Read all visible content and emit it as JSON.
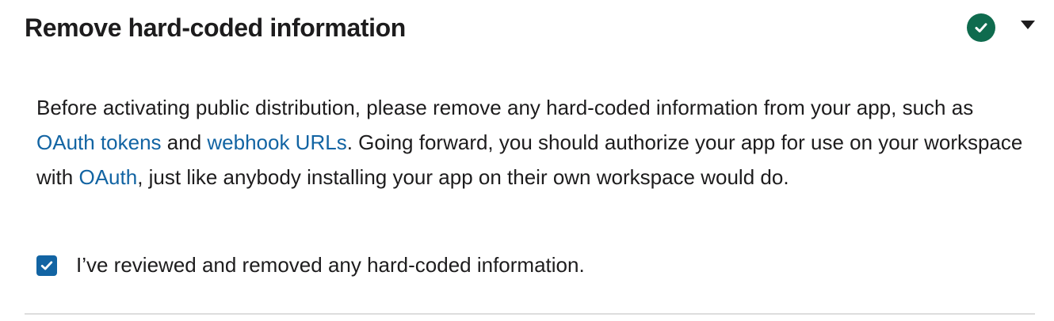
{
  "section": {
    "title": "Remove hard-coded information",
    "status_icon": "check-circle-icon",
    "status_color": "#0f6b4e",
    "toggle_icon": "caret-down-icon"
  },
  "description": {
    "part1": "Before activating public distribution, please remove any hard-coded information from your app, such as ",
    "link_oauth_tokens": "OAuth tokens",
    "part2": " and ",
    "link_webhook_urls": "webhook URLs",
    "part3": ". Going forward, you should authorize your app for use on your workspace with ",
    "link_oauth": "OAuth",
    "part4": ", just like anybody installing your app on their own workspace would do."
  },
  "confirmation": {
    "checked": true,
    "label": "I’ve reviewed and removed any hard-coded information."
  },
  "colors": {
    "link": "#1264a3",
    "checkbox": "#1264a3",
    "text": "#1d1c1d"
  }
}
